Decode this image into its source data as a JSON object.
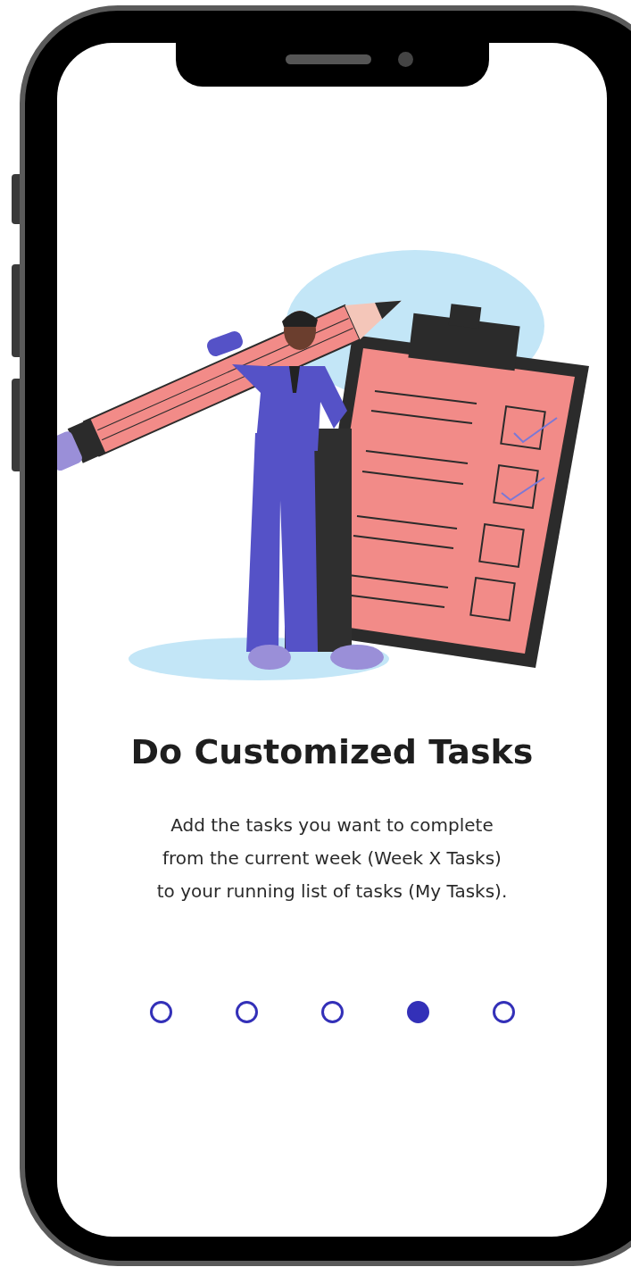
{
  "onboarding": {
    "title": "Do Customized Tasks",
    "description": [
      "Add the tasks you want to complete",
      "from the current week (Week X Tasks)",
      "to your running list of tasks (My Tasks)."
    ]
  },
  "pagination": [
    {
      "selected": false
    },
    {
      "selected": false
    },
    {
      "selected": false
    },
    {
      "selected": true
    },
    {
      "selected": false
    }
  ]
}
